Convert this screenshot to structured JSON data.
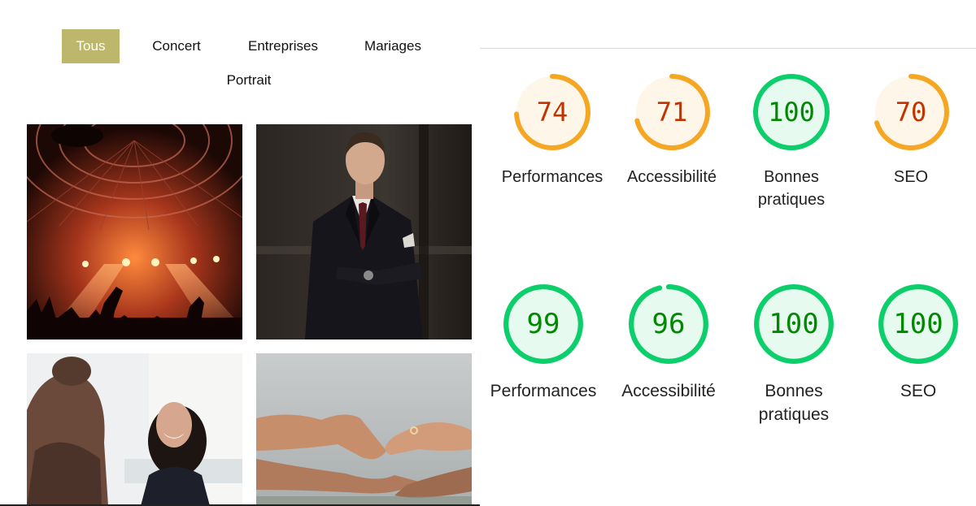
{
  "filters": {
    "all": "Tous",
    "concert": "Concert",
    "business": "Entreprises",
    "weddings": "Mariages",
    "portrait": "Portrait"
  },
  "photos": [
    {
      "subject": "concert-stage"
    },
    {
      "subject": "man-in-suit-portrait"
    },
    {
      "subject": "smiling-woman-office"
    },
    {
      "subject": "wedding-hands-ring"
    }
  ],
  "colors": {
    "accent": "#bdb76b",
    "score_average": "#f5a623",
    "score_average_text": "#c33300",
    "score_good": "#0cce6b",
    "score_good_text": "#008800"
  },
  "report_before": [
    {
      "score": "74",
      "label": "Performances",
      "status": "average"
    },
    {
      "score": "71",
      "label": "Accessibilité",
      "status": "average"
    },
    {
      "score": "100",
      "label": "Bonnes pratiques",
      "status": "good"
    },
    {
      "score": "70",
      "label": "SEO",
      "status": "average"
    }
  ],
  "report_after": [
    {
      "score": "99",
      "label": "Performances",
      "status": "good"
    },
    {
      "score": "96",
      "label": "Accessibilité",
      "status": "good"
    },
    {
      "score": "100",
      "label": "Bonnes pratiques",
      "status": "good"
    },
    {
      "score": "100",
      "label": "SEO",
      "status": "good"
    }
  ]
}
